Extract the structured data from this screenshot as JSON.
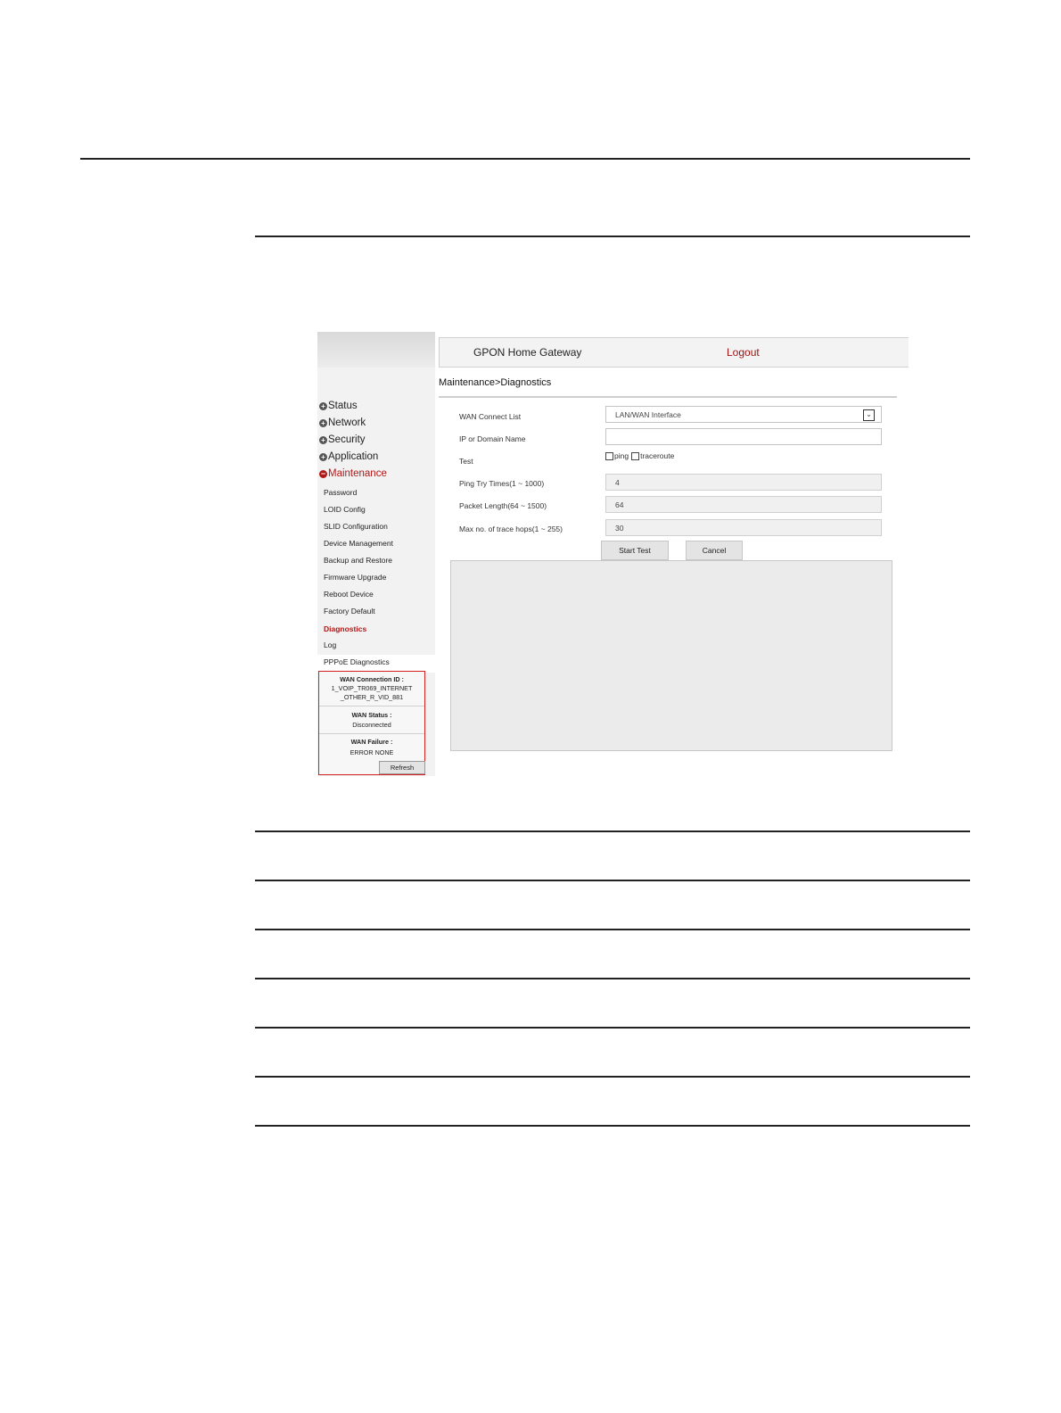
{
  "header": {
    "app_title": "GPON Home Gateway",
    "logout_label": "Logout"
  },
  "breadcrumb": "Maintenance>Diagnostics",
  "sidebar": {
    "menu": [
      {
        "label": "Status",
        "icon": "plus-icon"
      },
      {
        "label": "Network",
        "icon": "plus-icon"
      },
      {
        "label": "Security",
        "icon": "plus-icon"
      },
      {
        "label": "Application",
        "icon": "plus-icon"
      },
      {
        "label": "Maintenance",
        "icon": "minus-icon",
        "active": true
      }
    ],
    "sub_items": [
      {
        "label": "Password"
      },
      {
        "label": "LOID Config"
      },
      {
        "label": "SLID Configuration"
      },
      {
        "label": "Device Management"
      },
      {
        "label": "Backup and Restore"
      },
      {
        "label": "Firmware Upgrade"
      },
      {
        "label": "Reboot Device"
      },
      {
        "label": "Factory Default"
      },
      {
        "label": "Diagnostics",
        "active": true
      },
      {
        "label": "Log"
      },
      {
        "label": "PPPoE Diagnostics"
      }
    ]
  },
  "wan_info": {
    "connection_id_label": "WAN Connection ID :",
    "connection_id_value": "1_VOIP_TR069_INTERNET\n_OTHER_R_VID_881",
    "status_label": "WAN Status :",
    "status_value": "Disconnected",
    "failure_label": "WAN Failure :",
    "failure_value": "ERROR NONE",
    "refresh_label": "Refresh"
  },
  "form": {
    "wan_connect_list_label": "WAN Connect List",
    "wan_connect_list_value": "LAN/WAN Interface",
    "ip_domain_label": "IP or Domain Name",
    "ip_domain_value": "",
    "test_label": "Test",
    "test_options": [
      "ping",
      "traceroute"
    ],
    "ping_try_label": "Ping Try Times(1 ~ 1000)",
    "ping_try_value": "4",
    "packet_length_label": "Packet Length(64 ~ 1500)",
    "packet_length_value": "64",
    "max_hops_label": "Max no. of trace hops(1 ~ 255)",
    "max_hops_value": "30",
    "start_test_label": "Start Test",
    "cancel_label": "Cancel"
  },
  "colors": {
    "accent_red": "#b01818",
    "panel_gray": "#ebebeb",
    "wan_box_border": "#d32020"
  }
}
